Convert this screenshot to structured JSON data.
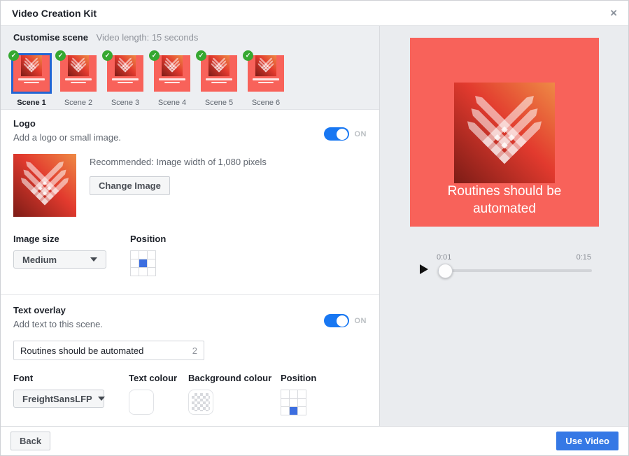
{
  "modal": {
    "title": "Video Creation Kit"
  },
  "icons": {
    "close": "×",
    "check": "✓"
  },
  "scene_strip": {
    "heading": "Customise scene",
    "video_length": "Video length: 15 seconds",
    "scenes": [
      {
        "label": "Scene 1",
        "selected": true
      },
      {
        "label": "Scene 2",
        "selected": false
      },
      {
        "label": "Scene 3",
        "selected": false
      },
      {
        "label": "Scene 4",
        "selected": false
      },
      {
        "label": "Scene 5",
        "selected": false
      },
      {
        "label": "Scene 6",
        "selected": false
      }
    ]
  },
  "logo_section": {
    "title": "Logo",
    "subtitle": "Add a logo or small image.",
    "toggle_state": "ON",
    "recommended": "Recommended: Image width of 1,080 pixels",
    "change_image_label": "Change Image",
    "image_size_label": "Image size",
    "image_size_value": "Medium",
    "position_label": "Position",
    "position_selected": "middle-center"
  },
  "text_overlay_section": {
    "title": "Text overlay",
    "subtitle": "Add text to this scene.",
    "toggle_state": "ON",
    "text_value": "Routines should be automated",
    "text_counter": "2",
    "font_label": "Font",
    "font_value": "FreightSansLFP",
    "text_colour_label": "Text colour",
    "text_colour_value": "#ffffff",
    "background_colour_label": "Background colour",
    "background_colour_value": "transparent",
    "position_label": "Position",
    "position_selected": "bottom-center"
  },
  "preview": {
    "overlay_text": "Routines should be automated",
    "current_time": "0:01",
    "total_time": "0:15"
  },
  "footer": {
    "back_label": "Back",
    "use_video_label": "Use Video"
  },
  "colors": {
    "accent_blue": "#1877f2",
    "button_blue": "#3578e5",
    "selection_blue": "#2266d4",
    "position_blue": "#3c6ee0",
    "check_green": "#36a831",
    "brand_coral": "#f8625a",
    "logo_gradient": [
      "#7c1c16",
      "#e23a2e",
      "#ee8a45"
    ]
  }
}
